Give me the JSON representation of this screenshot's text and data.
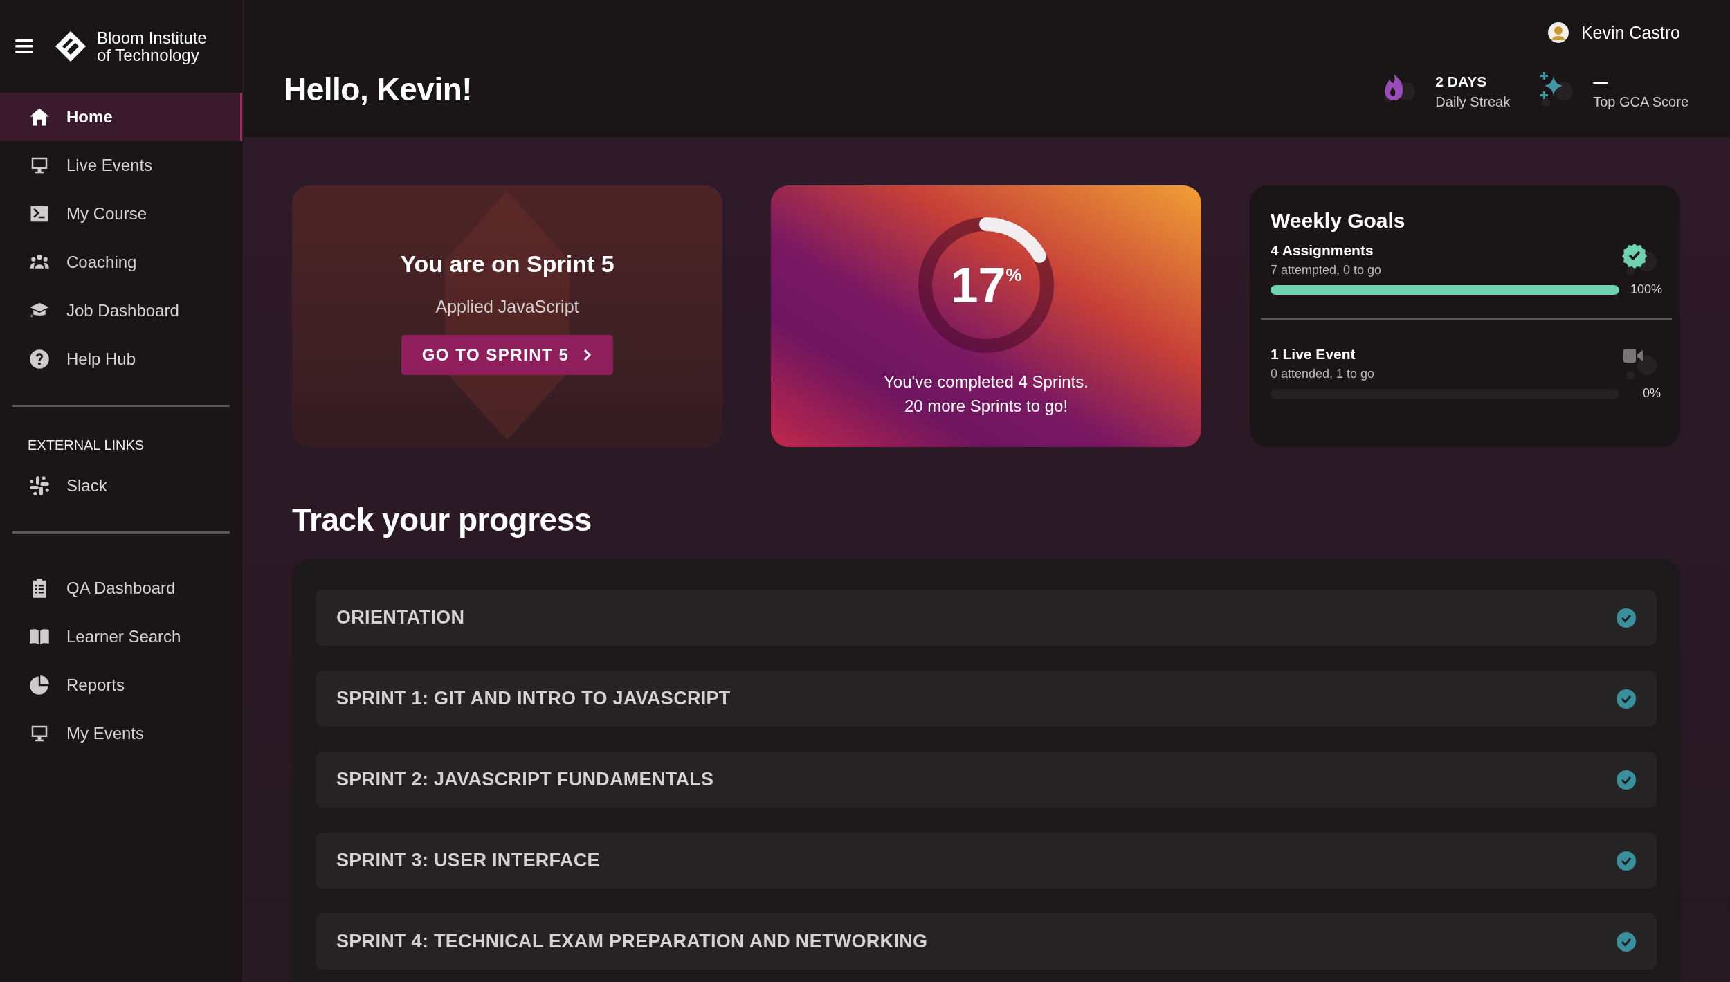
{
  "sidebar": {
    "brand": {
      "line1": "Bloom Institute",
      "line2": "of Technology"
    },
    "items": [
      {
        "label": "Home",
        "selected": true
      },
      {
        "label": "Live Events",
        "selected": false
      },
      {
        "label": "My Course",
        "selected": false
      },
      {
        "label": "Coaching",
        "selected": false
      },
      {
        "label": "Job Dashboard",
        "selected": false
      },
      {
        "label": "Help Hub",
        "selected": false
      }
    ],
    "external_heading": "EXTERNAL LINKS",
    "external_items": [
      {
        "label": "Slack",
        "selected": false
      }
    ],
    "admin_items": [
      {
        "label": "QA Dashboard",
        "selected": false
      },
      {
        "label": "Learner Search",
        "selected": false
      },
      {
        "label": "Reports",
        "selected": false
      },
      {
        "label": "My Events",
        "selected": false
      }
    ]
  },
  "header": {
    "greeting": "Hello, Kevin!",
    "user": "Kevin Castro",
    "stats": [
      {
        "kind": "streak",
        "value": "2 DAYS",
        "label": "Daily Streak"
      },
      {
        "kind": "score",
        "value": "—",
        "label": "Top GCA Score"
      }
    ]
  },
  "sprint_card": {
    "title": "You are on Sprint 5",
    "subtitle": "Applied JavaScript",
    "button": "GO TO SPRINT 5"
  },
  "progress_card": {
    "percent": "17",
    "unit": "%",
    "level": 0.17,
    "lines": [
      "You've completed 4 Sprints.",
      "20 more Sprints to go!"
    ]
  },
  "weekly_goals": {
    "title": "Weekly Goals",
    "goals": [
      {
        "kind": "assignments",
        "title": "4 Assignments",
        "detail": "7 attempted, 0 to go",
        "level": 1,
        "reading": "100%"
      },
      {
        "kind": "live_event",
        "title": "1 Live Event",
        "detail": "0 attended, 1 to go",
        "level": 0,
        "reading": "0%"
      }
    ]
  },
  "progress": {
    "title": "Track your progress",
    "sprints": [
      {
        "label": "ORIENTATION",
        "completed": true
      },
      {
        "label": "SPRINT 1: GIT AND INTRO TO JAVASCRIPT",
        "completed": true
      },
      {
        "label": "SPRINT 2: JAVASCRIPT FUNDAMENTALS",
        "completed": true
      },
      {
        "label": "SPRINT 3: USER INTERFACE",
        "completed": true
      },
      {
        "label": "SPRINT 4: TECHNICAL EXAM PREPARATION AND NETWORKING",
        "completed": true
      }
    ]
  }
}
